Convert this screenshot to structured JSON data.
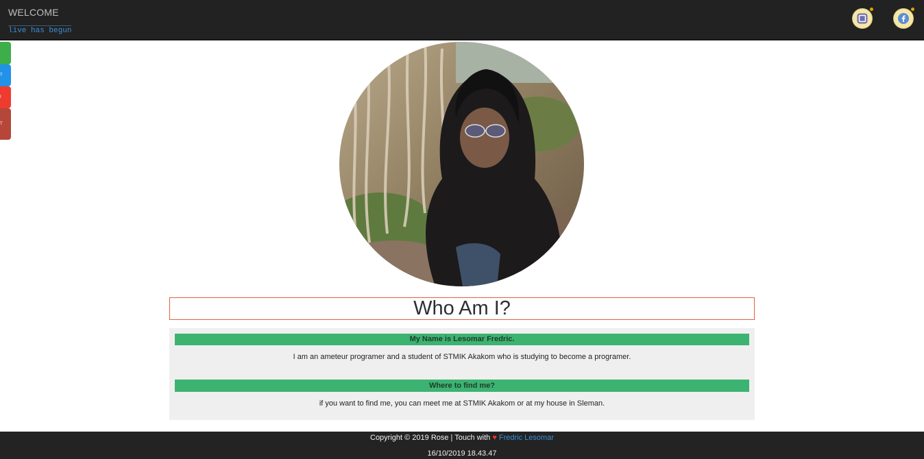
{
  "header": {
    "brand": "WELCOME",
    "tagline": "live has begun",
    "social": [
      "instagram-icon",
      "facebook-icon"
    ]
  },
  "side_tabs": [
    {
      "label": "",
      "color": "#3dae4a"
    },
    {
      "label": "T",
      "color": "#2291e8"
    },
    {
      "label": "I",
      "color": "#ef3b2f"
    },
    {
      "label": "T",
      "color": "#b6463a"
    }
  ],
  "main": {
    "title": "Who Am I?",
    "sections": [
      {
        "heading": "My Name is Lesomar Fredric.",
        "text": "I am an ameteur programer and a student of STMIK Akakom who is studying to become a programer."
      },
      {
        "heading": "Where to find me?",
        "text": "if you want to find me, you can meet me at STMIK Akakom or at my house in Sleman."
      }
    ]
  },
  "footer": {
    "copyright": "Copyright © 2019 Rose | Touch with",
    "heart": "♥",
    "author": "Fredric Lesomar",
    "timestamp": "16/10/2019 18.43.47"
  },
  "colors": {
    "accent_green": "#3cb371",
    "header_bg": "#222222",
    "link_blue": "#3a8fd8",
    "heading_border": "#e0603c"
  }
}
